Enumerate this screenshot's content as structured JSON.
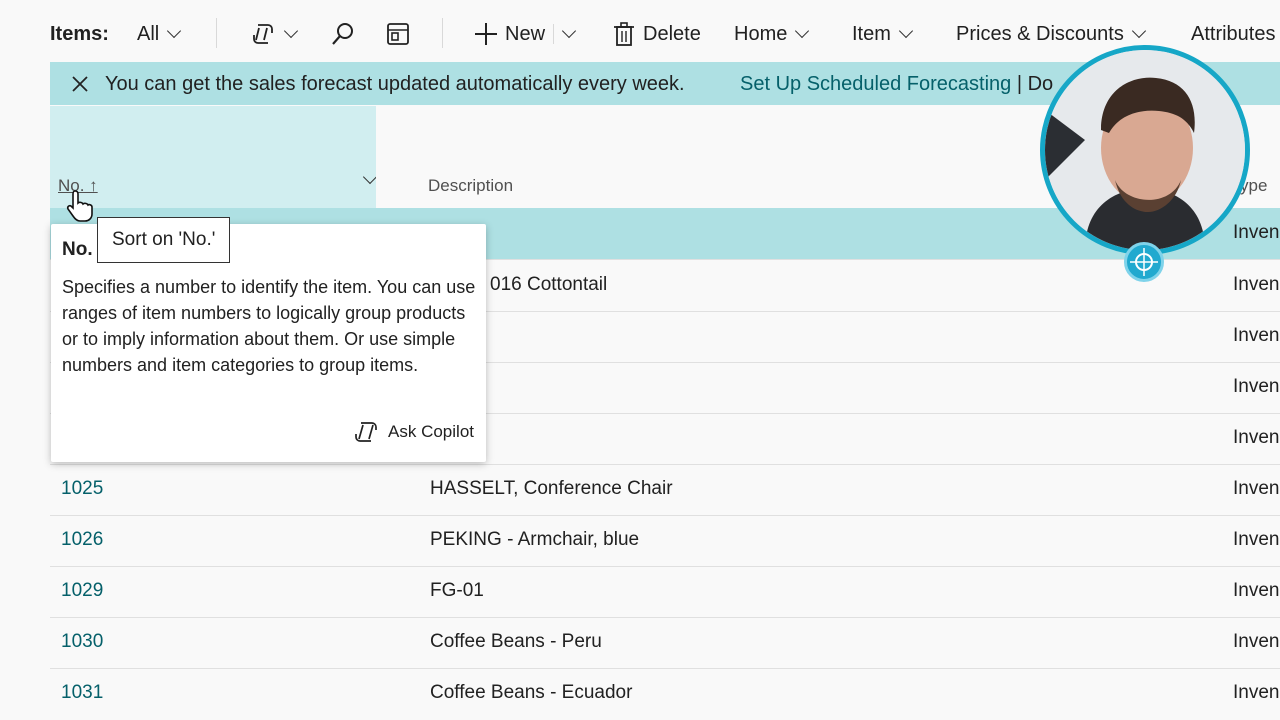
{
  "toolbar": {
    "items_label": "Items:",
    "filter_value": "All",
    "new_label": "New",
    "delete_label": "Delete",
    "home_label": "Home",
    "item_label": "Item",
    "prices_label": "Prices & Discounts",
    "attributes_label": "Attributes"
  },
  "banner": {
    "message": "You can get the sales forecast updated automatically every week.",
    "link": "Set Up Scheduled Forecasting",
    "link2": "| Do"
  },
  "columns": {
    "no": "No. ↑",
    "description": "Description",
    "type": "ype"
  },
  "rows": [
    {
      "no": "",
      "description": "",
      "type": "Inven"
    },
    {
      "no": "",
      "description": "016 Cottontail",
      "type": "Inven"
    },
    {
      "no": "",
      "description": "",
      "type": "Inven"
    },
    {
      "no": "",
      "description": "",
      "type": "Inven"
    },
    {
      "no": "",
      "description": "",
      "type": "Inven"
    },
    {
      "no": "1025",
      "description": "HASSELT, Conference Chair",
      "type": "Inven"
    },
    {
      "no": "1026",
      "description": "PEKING - Armchair, blue",
      "type": "Inven"
    },
    {
      "no": "1029",
      "description": "FG-01",
      "type": "Inven"
    },
    {
      "no": "1030",
      "description": "Coffee Beans - Peru",
      "type": "Inven"
    },
    {
      "no": "1031",
      "description": "Coffee Beans - Ecuador",
      "type": "Inven"
    }
  ],
  "tooltip": {
    "title": "No.",
    "body": "Specifies a number to identify the item. You can use ranges of item numbers to logically group products or to imply information about them. Or use simple numbers and item categories to group items.",
    "ask_copilot": "Ask Copilot"
  },
  "sort_tip": "Sort on 'No.'",
  "colors": {
    "accent": "#05606a",
    "banner_bg": "#aee0e3",
    "selected_row": "#aee0e3",
    "webcam_ring": "#16a7c7"
  }
}
